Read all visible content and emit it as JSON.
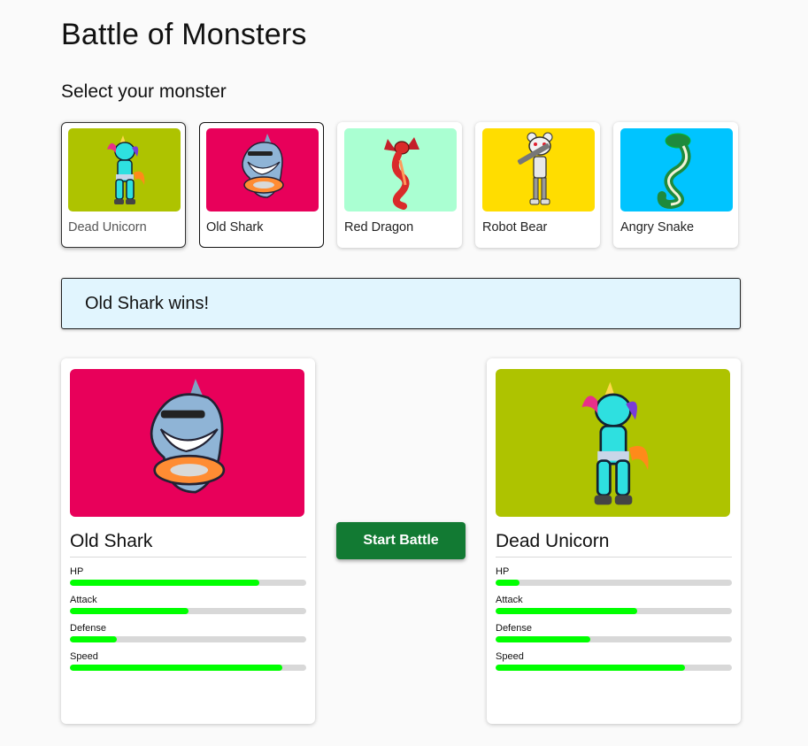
{
  "page": {
    "title": "Battle of Monsters",
    "subtitle": "Select your monster"
  },
  "monsters": [
    {
      "name": "Dead Unicorn",
      "bg": "#aec300",
      "icon": "unicorn-icon"
    },
    {
      "name": "Old Shark",
      "bg": "#e8005a",
      "icon": "shark-icon"
    },
    {
      "name": "Red Dragon",
      "bg": "#aaffd2",
      "icon": "dragon-icon"
    },
    {
      "name": "Robot Bear",
      "bg": "#ffdd00",
      "icon": "robot-bear-icon"
    },
    {
      "name": "Angry Snake",
      "bg": "#00c4ff",
      "icon": "snake-icon"
    }
  ],
  "winner_text": "Old Shark wins!",
  "battle": {
    "start_label": "Start Battle",
    "stat_color": "#00ff00",
    "left": {
      "name": "Old Shark",
      "bg": "#e8005a",
      "stats": [
        {
          "label": "HP",
          "value": 0.8
        },
        {
          "label": "Attack",
          "value": 0.5
        },
        {
          "label": "Defense",
          "value": 0.2
        },
        {
          "label": "Speed",
          "value": 0.9
        }
      ]
    },
    "right": {
      "name": "Dead Unicorn",
      "bg": "#aec300",
      "stats": [
        {
          "label": "HP",
          "value": 0.1
        },
        {
          "label": "Attack",
          "value": 0.6
        },
        {
          "label": "Defense",
          "value": 0.4
        },
        {
          "label": "Speed",
          "value": 0.8
        }
      ]
    }
  }
}
